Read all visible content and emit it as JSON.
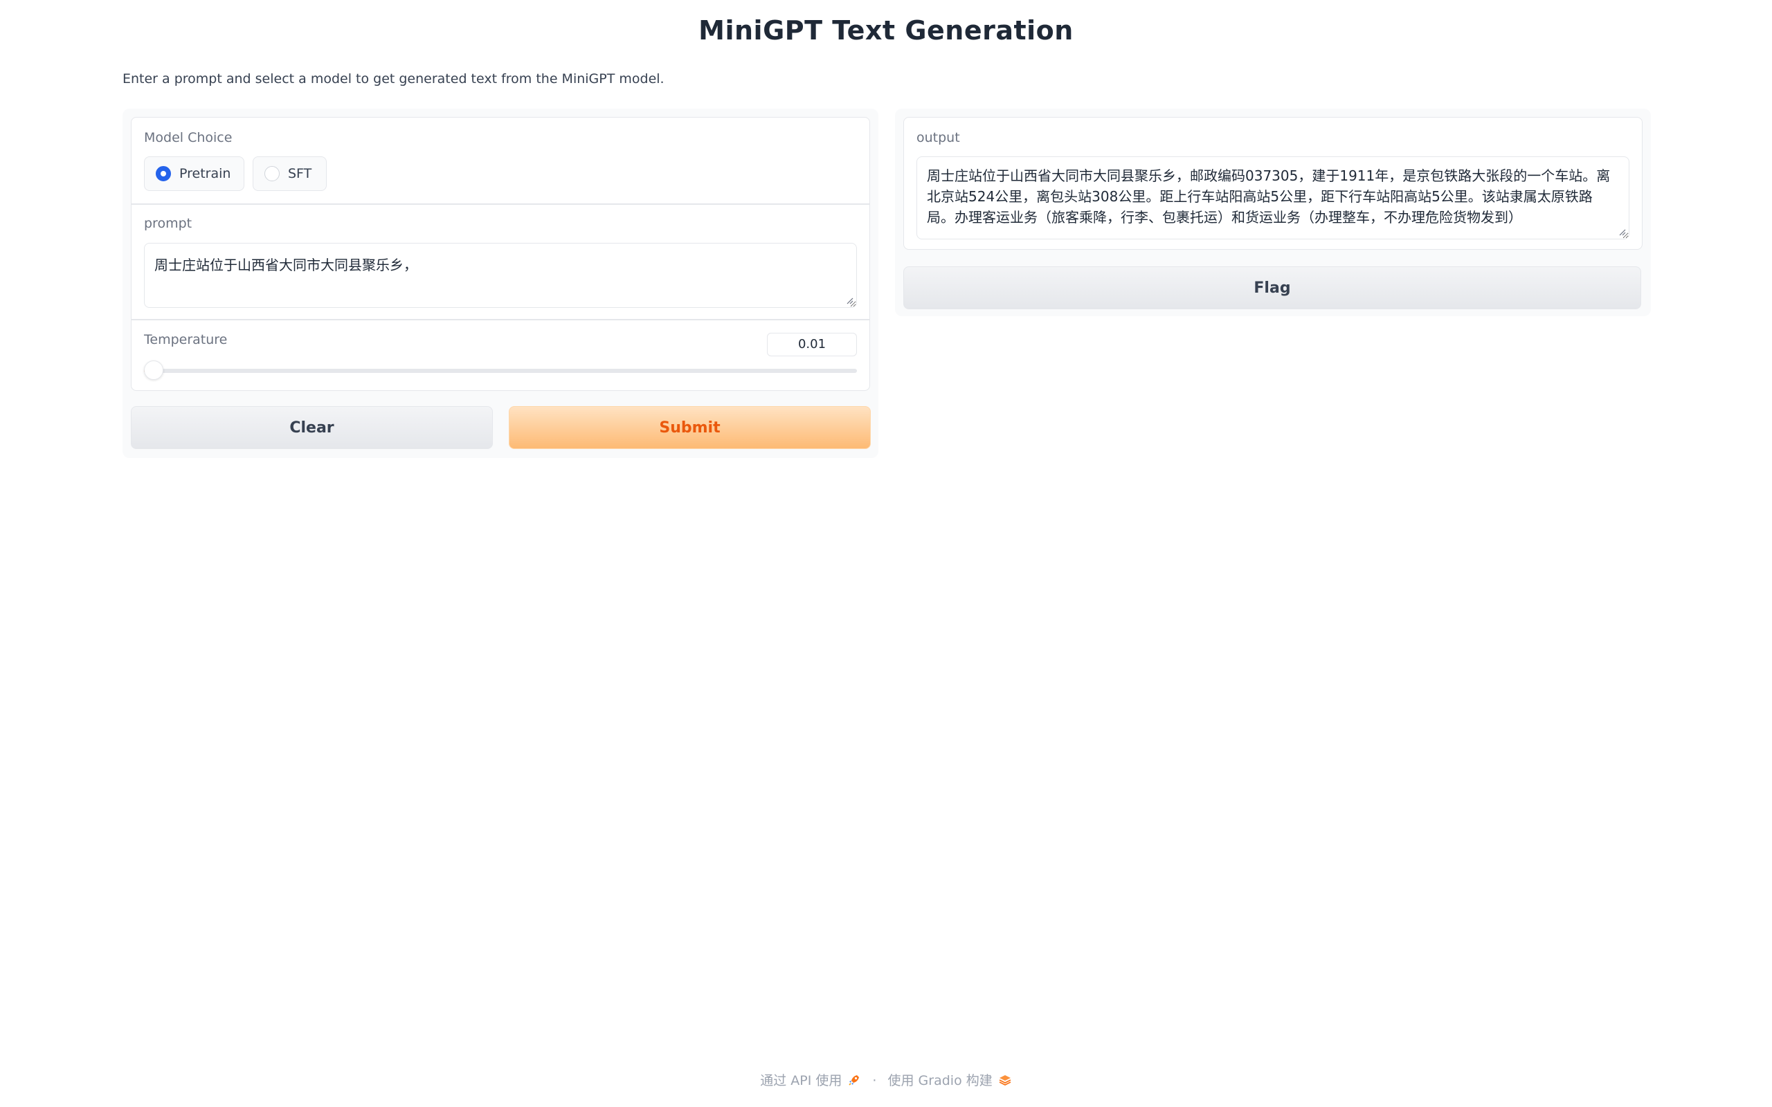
{
  "page": {
    "title": "MiniGPT Text Generation",
    "description": "Enter a prompt and select a model to get generated text from the MiniGPT model."
  },
  "inputs": {
    "model_choice": {
      "label": "Model Choice",
      "options": [
        "Pretrain",
        "SFT"
      ],
      "selected": "Pretrain"
    },
    "prompt": {
      "label": "prompt",
      "value": "周士庄站位于山西省大同市大同县聚乐乡，"
    },
    "temperature": {
      "label": "Temperature",
      "value": "0.01",
      "min": 0,
      "max": 1,
      "fraction": 0.01
    }
  },
  "buttons": {
    "clear": "Clear",
    "submit": "Submit",
    "flag": "Flag"
  },
  "output": {
    "label": "output",
    "value": "周士庄站位于山西省大同市大同县聚乐乡，邮政编码037305，建于1911年，是京包铁路大张段的一个车站。离北京站524公里，离包头站308公里。距上行车站阳高站5公里，距下行车站阳高站5公里。该站隶属太原铁路局。办理客运业务（旅客乘降，行李、包裹托运）和货运业务（办理整车，不办理危险货物发到）"
  },
  "footer": {
    "api_text": "通过 API 使用",
    "separator": "·",
    "built_text": "使用 Gradio 构建"
  },
  "colors": {
    "accent": "#2563eb",
    "submit_text": "#ea580c",
    "submit_bg": "#fdba74"
  },
  "icons": {
    "api": "rocket-icon",
    "gradio": "gradio-logo-icon"
  }
}
